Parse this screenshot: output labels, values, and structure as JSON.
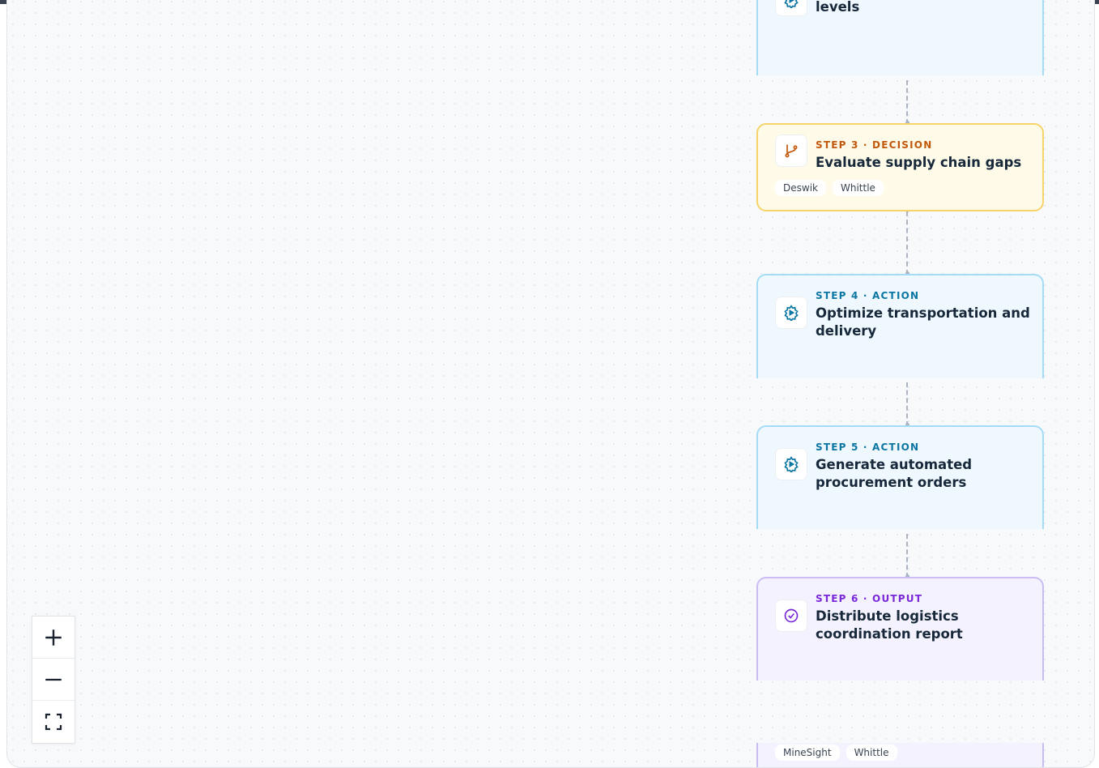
{
  "flow": {
    "steps": [
      {
        "label": "",
        "title": "Assess current inventory levels",
        "type": "action",
        "icon": "gear-play-icon",
        "tags": []
      },
      {
        "label": "STEP 3 · DECISION",
        "title": "Evaluate supply chain gaps",
        "type": "decision",
        "icon": "git-branch-icon",
        "tags": [
          "Deswik",
          "Whittle"
        ]
      },
      {
        "label": "STEP 4 · ACTION",
        "title": "Optimize transportation and delivery",
        "type": "action",
        "icon": "gear-play-icon",
        "tags": []
      },
      {
        "label": "STEP 5 · ACTION",
        "title": "Generate automated procurement orders",
        "type": "action",
        "icon": "gear-play-icon",
        "tags": []
      },
      {
        "label": "STEP 6 · OUTPUT",
        "title": "Distribute logistics coordination report",
        "type": "output",
        "icon": "check-circle-icon",
        "tags": []
      }
    ],
    "trailing_tags": [
      "MineSight",
      "Whittle"
    ]
  },
  "colors": {
    "action_accent": "#0b76a4",
    "decision_accent": "#c2580b",
    "output_accent": "#7a28d8",
    "title_text": "#17283a"
  },
  "controls": {
    "zoom_in_icon": "plus-icon",
    "zoom_out_icon": "minus-icon",
    "fit_view_icon": "fullscreen-icon"
  }
}
